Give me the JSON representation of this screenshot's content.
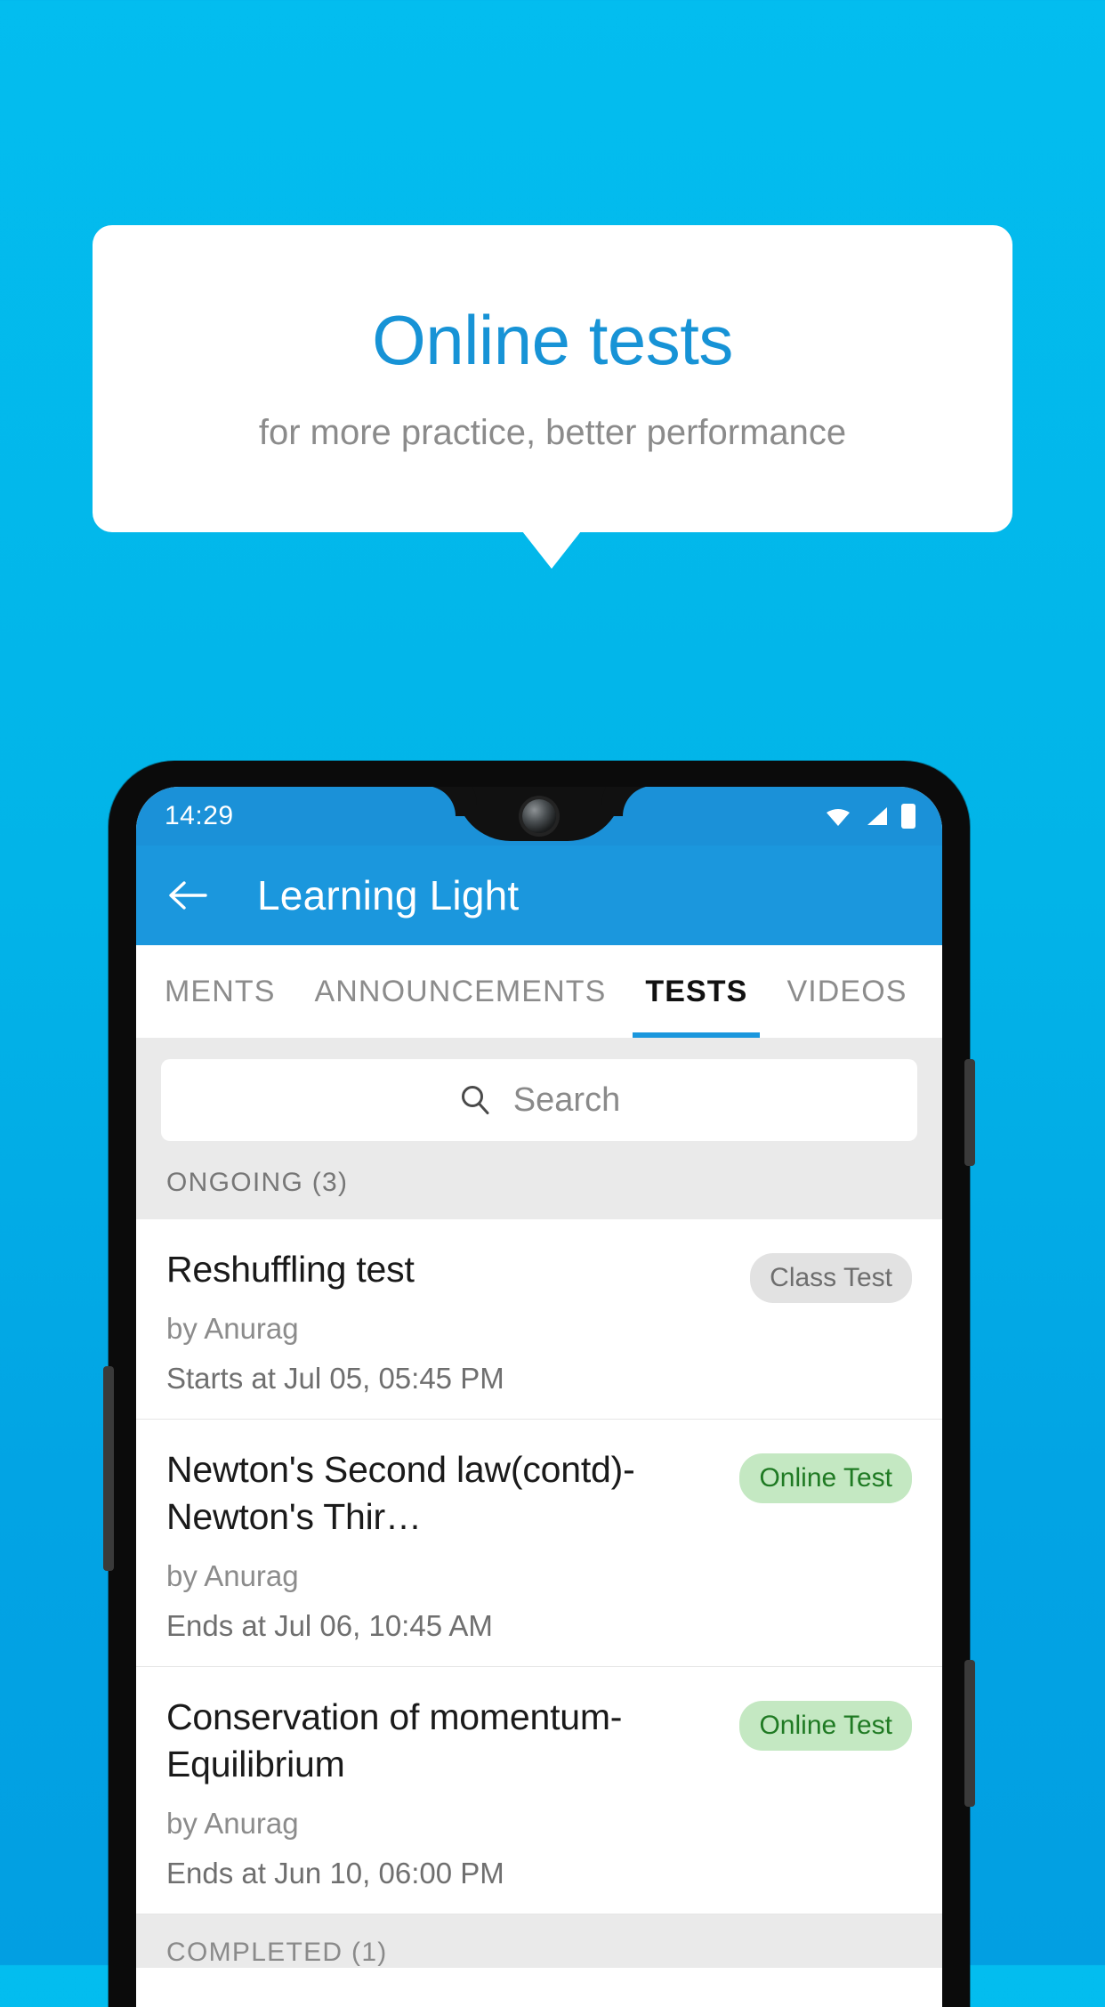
{
  "promo": {
    "title": "Online tests",
    "subtitle": "for more practice, better performance",
    "title_color": "#1793d6",
    "subtitle_color": "#8b8b8b"
  },
  "background": {
    "gradient_top": "#03bdef",
    "gradient_bottom": "#029fe2"
  },
  "phone": {
    "status_bar": {
      "time": "14:29",
      "icons": [
        "wifi-icon",
        "signal-icon",
        "battery-icon"
      ],
      "background": "#1b91d8"
    },
    "app_bar": {
      "back_icon": "back-arrow-icon",
      "title": "Learning Light",
      "background": "#1b97dd"
    },
    "tabs": [
      {
        "label": "MENTS",
        "active": false
      },
      {
        "label": "ANNOUNCEMENTS",
        "active": false
      },
      {
        "label": "TESTS",
        "active": true
      },
      {
        "label": "VIDEOS",
        "active": false
      }
    ],
    "tab_indicator_color": "#1b97dd",
    "search": {
      "icon": "search-icon",
      "placeholder": "Search"
    },
    "sections": [
      {
        "label": "ONGOING (3)"
      },
      {
        "label": "COMPLETED (1)"
      }
    ],
    "tests": [
      {
        "title": "Reshuffling test",
        "badge": "Class Test",
        "badge_type": "grey",
        "author": "by Anurag",
        "schedule": "Starts at  Jul 05, 05:45 PM"
      },
      {
        "title": "Newton's Second law(contd)-Newton's Thir…",
        "badge": "Online Test",
        "badge_type": "green",
        "author": "by Anurag",
        "schedule": "Ends at  Jul 06, 10:45 AM"
      },
      {
        "title": "Conservation of momentum-Equilibrium",
        "badge": "Online Test",
        "badge_type": "green",
        "author": "by Anurag",
        "schedule": "Ends at  Jun 10, 06:00 PM"
      }
    ]
  }
}
